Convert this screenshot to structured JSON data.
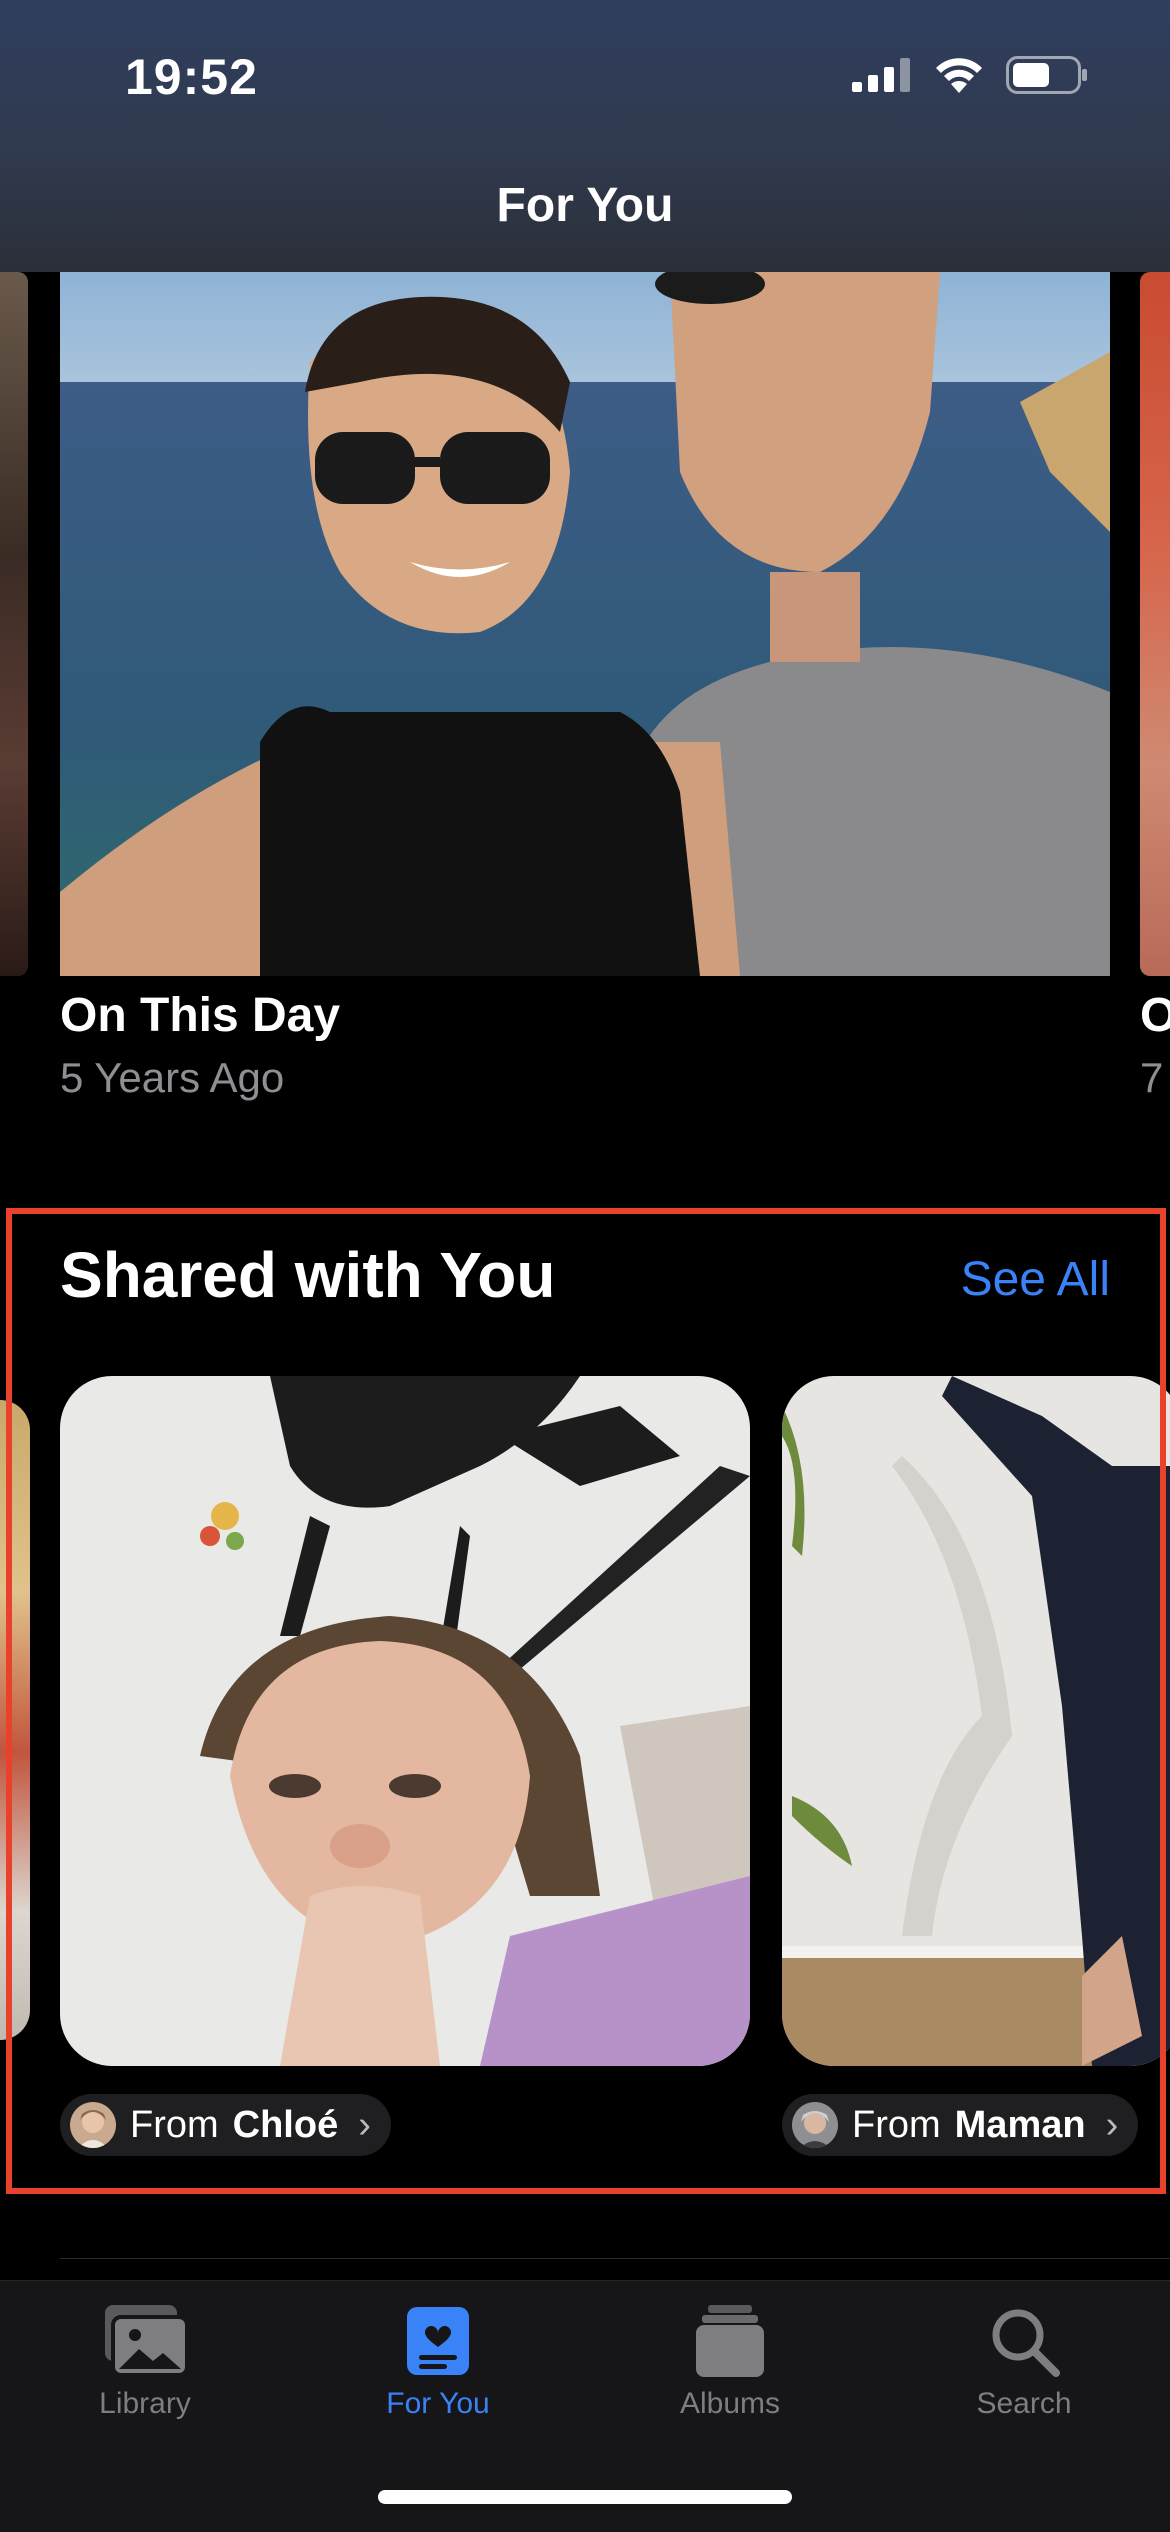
{
  "status_bar": {
    "time": "19:52"
  },
  "nav": {
    "title": "For You"
  },
  "memory": {
    "title": "On This Day",
    "subtitle": "5 Years Ago",
    "peek_title": "O",
    "peek_subtitle": "7"
  },
  "shared": {
    "title": "Shared with You",
    "see_all": "See All",
    "items": [
      {
        "from_prefix": "From",
        "from_name": "Chloé"
      },
      {
        "from_prefix": "From",
        "from_name": "Maman"
      }
    ]
  },
  "tabs": [
    {
      "label": "Library",
      "icon": "photo-library-icon"
    },
    {
      "label": "For You",
      "icon": "for-you-icon"
    },
    {
      "label": "Albums",
      "icon": "albums-icon"
    },
    {
      "label": "Search",
      "icon": "search-icon"
    }
  ],
  "colors": {
    "accent": "#3a82f7",
    "highlight": "#e8412c",
    "inactive_tab": "#7d7d82"
  },
  "active_tab": "For You"
}
